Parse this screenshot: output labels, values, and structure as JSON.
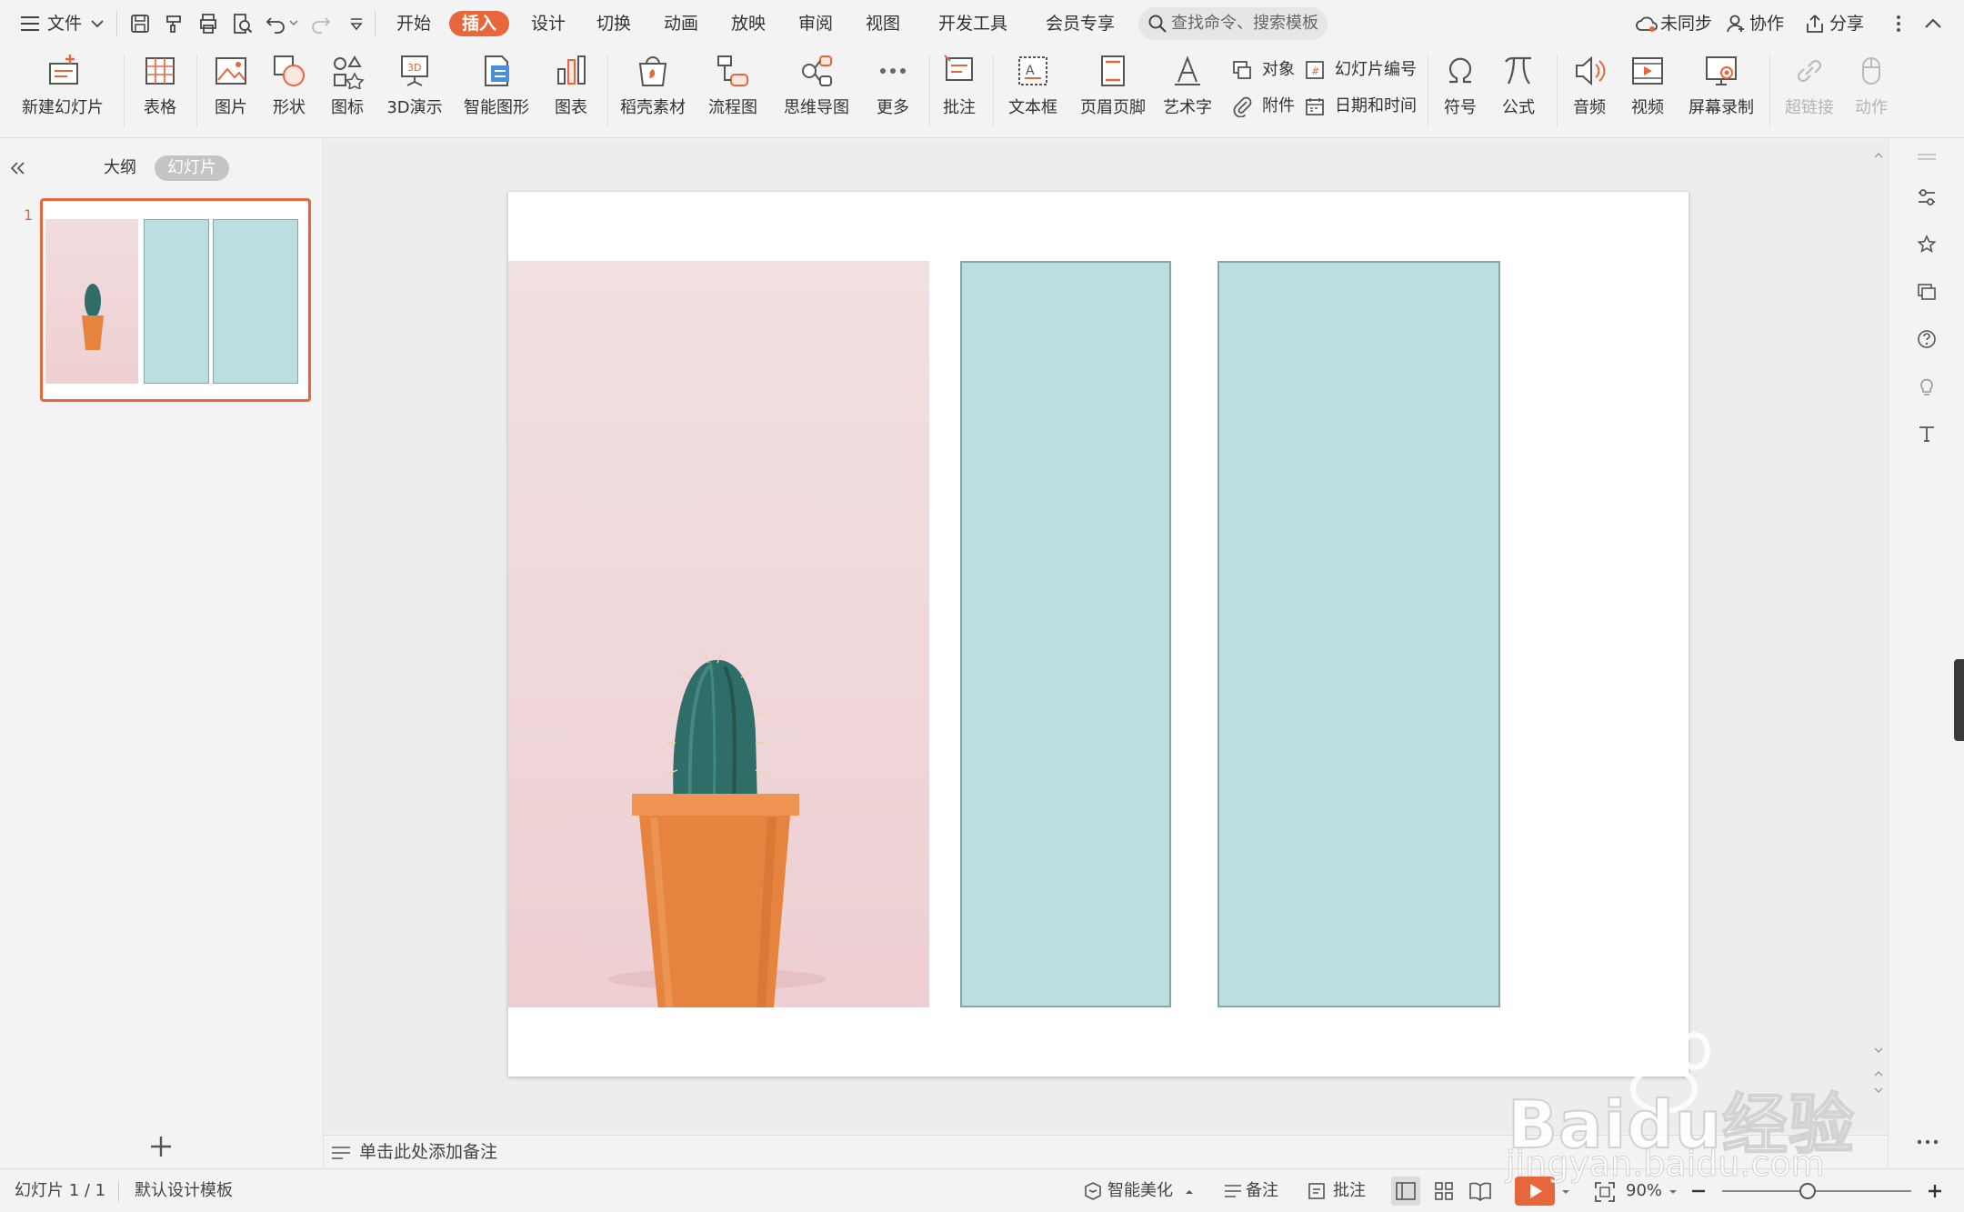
{
  "menubar": {
    "file_label": "文件",
    "tabs": [
      {
        "label": "开始"
      },
      {
        "label": "插入"
      },
      {
        "label": "设计"
      },
      {
        "label": "切换"
      },
      {
        "label": "动画"
      },
      {
        "label": "放映"
      },
      {
        "label": "审阅"
      },
      {
        "label": "视图"
      },
      {
        "label": "开发工具"
      },
      {
        "label": "会员专享"
      }
    ],
    "active_tab": "插入",
    "search_placeholder": "查找命令、搜索模板",
    "sync_label": "未同步",
    "collab_label": "协作",
    "share_label": "分享"
  },
  "ribbon": {
    "new_slide": "新建幻灯片",
    "table": "表格",
    "picture": "图片",
    "shape": "形状",
    "icon": "图标",
    "demo3d": "3D演示",
    "smartart": "智能图形",
    "chart": "图表",
    "material": "稻壳素材",
    "flowchart": "流程图",
    "mindmap": "思维导图",
    "more": "更多",
    "comment": "批注",
    "textbox": "文本框",
    "header_footer": "页眉页脚",
    "wordart": "艺术字",
    "object": "对象",
    "slide_number": "幻灯片编号",
    "attachment": "附件",
    "datetime": "日期和时间",
    "symbol": "符号",
    "formula": "公式",
    "audio": "音频",
    "video": "视频",
    "screen_record": "屏幕录制",
    "hyperlink": "超链接",
    "action": "动作"
  },
  "leftpanel": {
    "tab_outline": "大纲",
    "tab_slides": "幻灯片",
    "slide_number": "1"
  },
  "notes": {
    "placeholder": "单击此处添加备注"
  },
  "statusbar": {
    "slide_info": "幻灯片 1 / 1",
    "template": "默认设计模板",
    "beautify": "智能美化",
    "notes": "备注",
    "comment": "批注",
    "zoom": "90%",
    "zoom_level": 0.45
  },
  "watermark": {
    "text1": "Baidu经验",
    "text2": "jingyan.baidu.com"
  },
  "colors": {
    "accent": "#e8663c",
    "teal_box": "#bbdfe0",
    "teal_border": "#7fa9ab",
    "photo_bg": "#f1d6d8",
    "pot": "#e6843f",
    "cactus": "#2f6d68"
  }
}
